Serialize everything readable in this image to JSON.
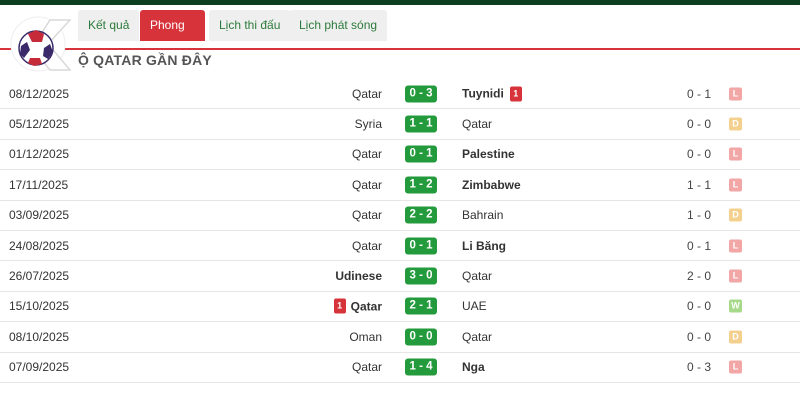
{
  "tabs": [
    {
      "label": "Kết quả",
      "active": false
    },
    {
      "label": "Phong độ",
      "active": true
    },
    {
      "label": "Lịch thi đấu",
      "active": false
    },
    {
      "label": "Lịch phát sóng",
      "active": false
    }
  ],
  "section_title": "Ộ QATAR GẦN ĐÂY",
  "logo": {
    "text": "K",
    "icon": "soccer-ball-icon"
  },
  "colors": {
    "accent": "#d6333b",
    "score_bg": "#239a3b",
    "tab_text": "#2c7a3b",
    "loss": "#f2a6a6",
    "draw": "#f4d08f",
    "win": "#a7d98a"
  },
  "matches": [
    {
      "date": "08/12/2025",
      "home": "Qatar",
      "home_bold": false,
      "home_card": "",
      "score": "0 - 3",
      "away": "Tuynidi",
      "away_bold": true,
      "away_card": "1",
      "ht": "0 - 1",
      "result": "L"
    },
    {
      "date": "05/12/2025",
      "home": "Syria",
      "home_bold": false,
      "home_card": "",
      "score": "1 - 1",
      "away": "Qatar",
      "away_bold": false,
      "away_card": "",
      "ht": "0 - 0",
      "result": "D"
    },
    {
      "date": "01/12/2025",
      "home": "Qatar",
      "home_bold": false,
      "home_card": "",
      "score": "0 - 1",
      "away": "Palestine",
      "away_bold": true,
      "away_card": "",
      "ht": "0 - 0",
      "result": "L"
    },
    {
      "date": "17/11/2025",
      "home": "Qatar",
      "home_bold": false,
      "home_card": "",
      "score": "1 - 2",
      "away": "Zimbabwe",
      "away_bold": true,
      "away_card": "",
      "ht": "1 - 1",
      "result": "L"
    },
    {
      "date": "03/09/2025",
      "home": "Qatar",
      "home_bold": false,
      "home_card": "",
      "score": "2 - 2",
      "away": "Bahrain",
      "away_bold": false,
      "away_card": "",
      "ht": "1 - 0",
      "result": "D"
    },
    {
      "date": "24/08/2025",
      "home": "Qatar",
      "home_bold": false,
      "home_card": "",
      "score": "0 - 1",
      "away": "Li Băng",
      "away_bold": true,
      "away_card": "",
      "ht": "0 - 1",
      "result": "L"
    },
    {
      "date": "26/07/2025",
      "home": "Udinese",
      "home_bold": true,
      "home_card": "",
      "score": "3 - 0",
      "away": "Qatar",
      "away_bold": false,
      "away_card": "",
      "ht": "2 - 0",
      "result": "L"
    },
    {
      "date": "15/10/2025",
      "home": "Qatar",
      "home_bold": true,
      "home_card": "1",
      "score": "2 - 1",
      "away": "UAE",
      "away_bold": false,
      "away_card": "",
      "ht": "0 - 0",
      "result": "W"
    },
    {
      "date": "08/10/2025",
      "home": "Oman",
      "home_bold": false,
      "home_card": "",
      "score": "0 - 0",
      "away": "Qatar",
      "away_bold": false,
      "away_card": "",
      "ht": "0 - 0",
      "result": "D"
    },
    {
      "date": "07/09/2025",
      "home": "Qatar",
      "home_bold": false,
      "home_card": "",
      "score": "1 - 4",
      "away": "Nga",
      "away_bold": true,
      "away_card": "",
      "ht": "0 - 3",
      "result": "L"
    }
  ]
}
